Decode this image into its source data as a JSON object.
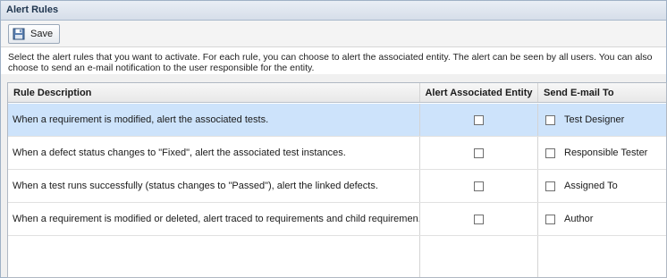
{
  "panel": {
    "title": "Alert Rules"
  },
  "toolbar": {
    "save_label": "Save",
    "save_icon": "save-disk-icon"
  },
  "description": "Select the alert rules that you want to activate. For each rule, you can choose to alert the associated entity. The alert can be seen by all users. You can also choose to send an e-mail notification to the user responsible for the entity.",
  "table": {
    "columns": [
      "Rule Description",
      "Alert Associated Entity",
      "Send E-mail To"
    ],
    "rows": [
      {
        "description": "When a requirement is modified, alert the associated tests.",
        "alert_entity": false,
        "email": false,
        "email_to": "Test Designer",
        "selected": true
      },
      {
        "description": "When a defect status changes to \"Fixed\", alert the associated test instances.",
        "alert_entity": false,
        "email": false,
        "email_to": "Responsible Tester",
        "selected": false
      },
      {
        "description": "When a test runs successfully (status changes to \"Passed\"), alert the linked defects.",
        "alert_entity": false,
        "email": false,
        "email_to": "Assigned To",
        "selected": false
      },
      {
        "description": "When a requirement is modified or deleted, alert traced to requirements and child requiremen..",
        "alert_entity": false,
        "email": false,
        "email_to": "Author",
        "selected": false
      }
    ]
  },
  "colors": {
    "selected_row": "#cde3fb",
    "title_text": "#20364f"
  }
}
